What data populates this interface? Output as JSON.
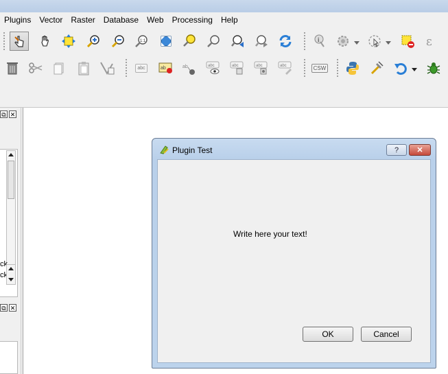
{
  "menubar": {
    "items": [
      "Plugins",
      "Vector",
      "Raster",
      "Database",
      "Web",
      "Processing",
      "Help"
    ]
  },
  "toolbar1": {
    "icons": [
      "pan-selected-icon",
      "pan-hand-icon",
      "pan-to-selection-icon",
      "zoom-in-icon",
      "zoom-out-icon",
      "zoom-native-icon",
      "zoom-full-icon",
      "zoom-to-selection-icon",
      "zoom-to-layer-icon",
      "zoom-last-icon",
      "zoom-next-icon",
      "refresh-icon",
      "identify-icon",
      "action-icon",
      "select-features-icon",
      "deselect-icon",
      "measure-icon"
    ]
  },
  "toolbar2": {
    "icons": [
      "delete-icon",
      "cut-icon",
      "copy-icon",
      "paste-icon",
      "node-tool-icon",
      "label-icon",
      "label-pin-icon",
      "label-move-icon",
      "label-show-hide-icon",
      "label-move2-icon",
      "label-rotate-icon",
      "label-change-icon",
      "csw-icon",
      "python-icon",
      "processing-icon",
      "undo-icon",
      "bug-icon"
    ],
    "label_text": "abc",
    "csw_text": "CSW"
  },
  "left_panel": {
    "float_glyph": "⧉",
    "close_glyph": "✕",
    "truncated_labels": [
      "ck",
      "ck"
    ]
  },
  "dialog": {
    "title": "Plugin Test",
    "help_label": "?",
    "close_label": "✕",
    "message": "Write here your text!",
    "ok_label": "OK",
    "cancel_label": "Cancel"
  }
}
